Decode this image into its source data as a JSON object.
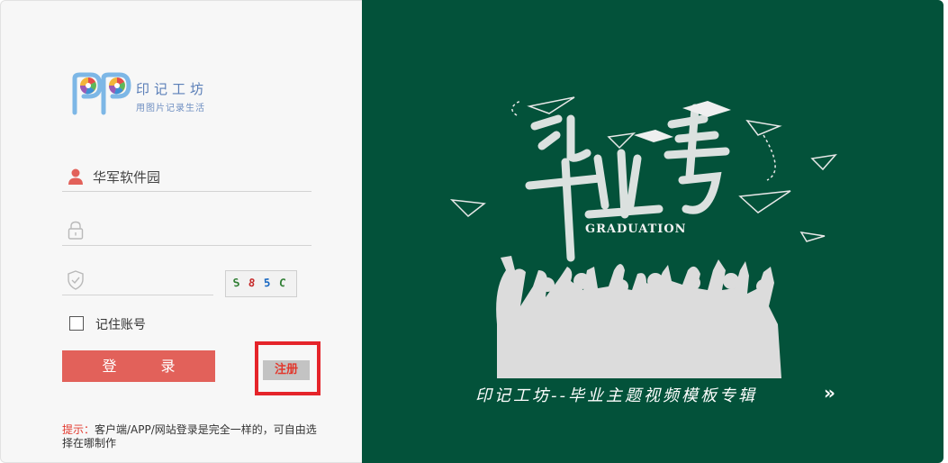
{
  "logo": {
    "title": "印记工坊",
    "subtitle": "用图片记录生活"
  },
  "form": {
    "username_value": "华军软件园",
    "password_value": "",
    "captcha_input_value": "",
    "captcha_text": [
      "S",
      "8",
      "5",
      "C"
    ],
    "remember_label": "记住账号",
    "remember_checked": false,
    "login_label": "登 录",
    "register_label": "注册"
  },
  "hint": {
    "label": "提示：",
    "text": "客户端/APP/网站登录是完全一样的，可自由选择在哪制作"
  },
  "banner": {
    "title": "毕业季",
    "graduation_word": "GRADUATION",
    "caption": "印记工坊--毕业主题视频模板专辑",
    "arrows": "»",
    "background_color": "#03523a"
  },
  "colors": {
    "accent": "#e2615a",
    "highlight_border": "#e5242a",
    "hint_label": "#e2382d"
  }
}
